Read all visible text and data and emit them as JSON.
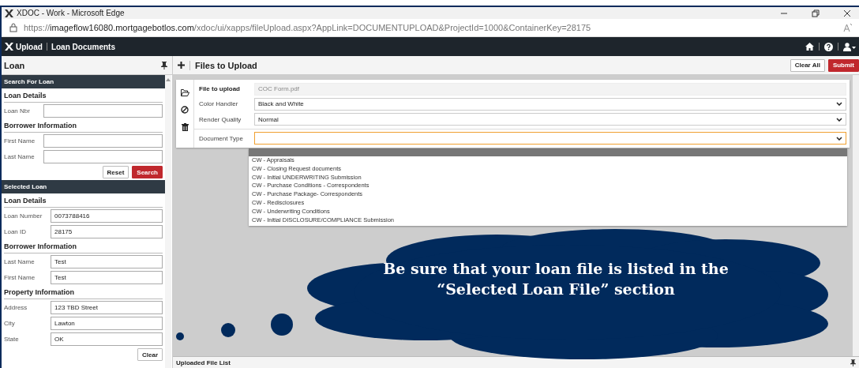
{
  "browser": {
    "title": "XDOC - Work - Microsoft Edge",
    "url_prefix": "https://",
    "url_host": "imageflow16080.mortgagebotlos.com",
    "url_path": "/xdoc/ui/xapps/fileUpload.aspx?AppLink=DOCUMENTUPLOAD&ProjectId=1000&ContainerKey=28175"
  },
  "app": {
    "module": "Upload",
    "page": "Loan Documents"
  },
  "left_panel": {
    "title": "Loan",
    "sections": [
      {
        "title": "Search For Loan",
        "groups": [
          {
            "title": "Loan Details",
            "fields": [
              {
                "label": "Loan Nbr"
              }
            ]
          },
          {
            "title": "Borrower Information",
            "fields": [
              {
                "label": "First Name"
              },
              {
                "label": "Last Name"
              }
            ],
            "buttons": [
              {
                "label": "Reset",
                "primary": false
              },
              {
                "label": "Search",
                "primary": true
              }
            ]
          }
        ]
      },
      {
        "title": "Selected Loan",
        "groups": [
          {
            "title": "Loan Details",
            "fields": [
              {
                "label": "Loan Number",
                "value": "0073788416"
              },
              {
                "label": "Loan ID",
                "value": "28175"
              }
            ]
          },
          {
            "title": "Borrower Information",
            "fields": [
              {
                "label": "Last Name",
                "value": "Test"
              },
              {
                "label": "First Name",
                "value": "Test"
              }
            ]
          },
          {
            "title": "Property Information",
            "fields": [
              {
                "label": "Address",
                "value": "123 TBD Street"
              },
              {
                "label": "City",
                "value": "Lawton"
              },
              {
                "label": "State",
                "value": "OK"
              }
            ],
            "buttons": [
              {
                "label": "Clear",
                "primary": false
              }
            ]
          }
        ]
      }
    ]
  },
  "main": {
    "title": "Files to Upload",
    "buttons": [
      {
        "label": "Clear All",
        "primary": false
      },
      {
        "label": "Submit",
        "primary": true
      }
    ],
    "fields": [
      {
        "label": "File to upload",
        "value": "COC Form.pdf",
        "kind": "readonly"
      },
      {
        "label": "Color Handler",
        "value": "Black and White",
        "kind": "select"
      },
      {
        "label": "Render Quality",
        "value": "Normal",
        "kind": "select"
      },
      {
        "label": "Document Type",
        "kind": "select",
        "focused": true
      }
    ],
    "dropdown": {
      "blank_highlighted": true,
      "options": [
        "CW - Appraisals",
        "CW - Closing Request documents",
        "CW - Initial UNDERWRITING Submission",
        "CW - Purchase Conditions - Correspondents",
        "CW - Purchase Package- Correspondents",
        "CW - Redisclosures",
        "CW - Underwriting Conditions",
        "CW - Initial DISCLOSURE/COMPLIANCE Submission"
      ]
    }
  },
  "callout": {
    "text": "Be sure that your loan file is listed in the “Selected Loan File” section"
  },
  "bottom_panel": {
    "title": "Uploaded File List"
  }
}
